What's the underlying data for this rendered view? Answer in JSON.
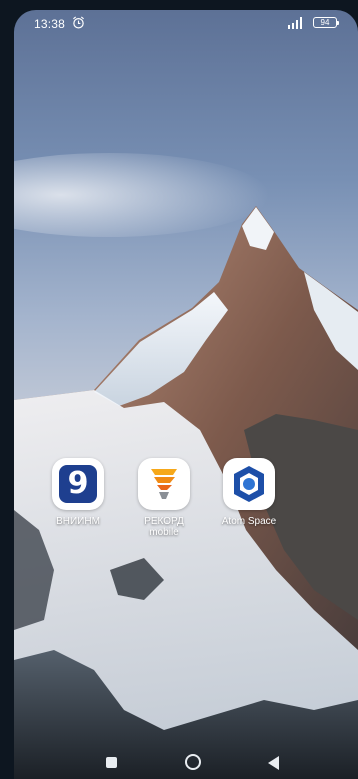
{
  "status_bar": {
    "time": "13:38",
    "battery": "94",
    "icons": [
      "alarm-icon",
      "signal-icon",
      "battery-icon"
    ]
  },
  "apps": [
    {
      "label": "ВНИИНМ",
      "icon": "vniinm-logo-icon",
      "glyph": "9",
      "color": "#1e3f8f"
    },
    {
      "label": "РЕКОРД\nmobile",
      "icon": "rekord-logo-icon",
      "color": "#f6a81a"
    },
    {
      "label": "Atom Space",
      "icon": "atom-space-logo-icon",
      "color": "#1d4fa8"
    }
  ],
  "nav_bar": {
    "icons": [
      "recent-apps-icon",
      "home-icon",
      "back-icon"
    ]
  }
}
